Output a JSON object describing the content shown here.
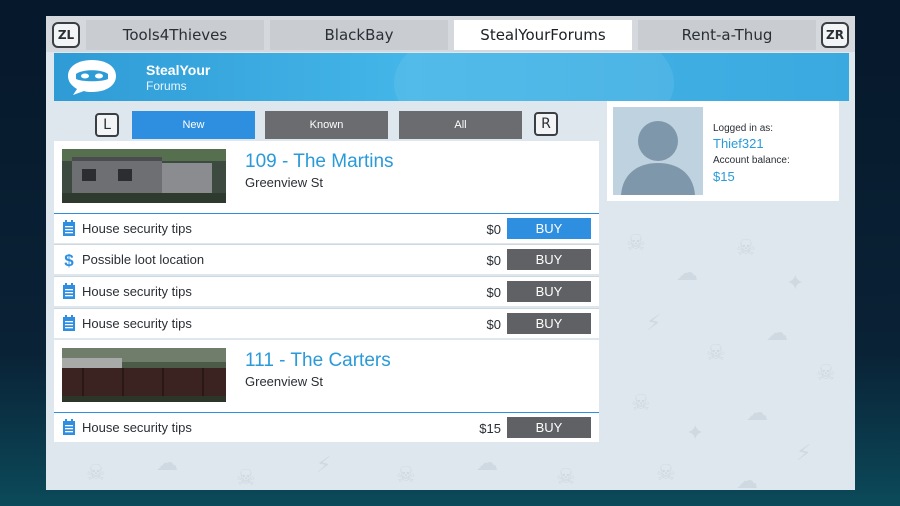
{
  "tabs": {
    "left_shoulder": "ZL",
    "right_shoulder": "ZR",
    "items": [
      {
        "label": "Tools4Thieves"
      },
      {
        "label": "BlackBay"
      },
      {
        "label": "StealYourForums"
      },
      {
        "label": "Rent-a-Thug"
      }
    ],
    "active_index": 2
  },
  "header": {
    "brand_line1": "StealYour",
    "brand_line2": "Forums",
    "logo_icon": "masked-speech-bubble-icon",
    "color": "#3aa9df"
  },
  "filters": {
    "left_shoulder": "L",
    "right_shoulder": "R",
    "options": [
      "New",
      "Known",
      "All"
    ],
    "active": "New",
    "accent": "#2e8fe0"
  },
  "listings": [
    {
      "title": "109 - The Martins",
      "street": "Greenview St",
      "items": [
        {
          "icon": "notepad-icon",
          "label": "House security tips",
          "price": "$0",
          "action": "BUY"
        },
        {
          "icon": "dollar-icon",
          "label": "Possible loot location",
          "price": "$0",
          "action": "BUY"
        },
        {
          "icon": "notepad-icon",
          "label": "House security tips",
          "price": "$0",
          "action": "BUY"
        },
        {
          "icon": "notepad-icon",
          "label": "House security tips",
          "price": "$0",
          "action": "BUY"
        }
      ]
    },
    {
      "title": "111 - The Carters",
      "street": "Greenview St",
      "items": [
        {
          "icon": "notepad-icon",
          "label": "House security tips",
          "price": "$15",
          "action": "BUY"
        }
      ]
    }
  ],
  "account": {
    "logged_in_label": "Logged in as:",
    "username": "Thief321",
    "balance_label": "Account balance:",
    "balance": "$15"
  }
}
